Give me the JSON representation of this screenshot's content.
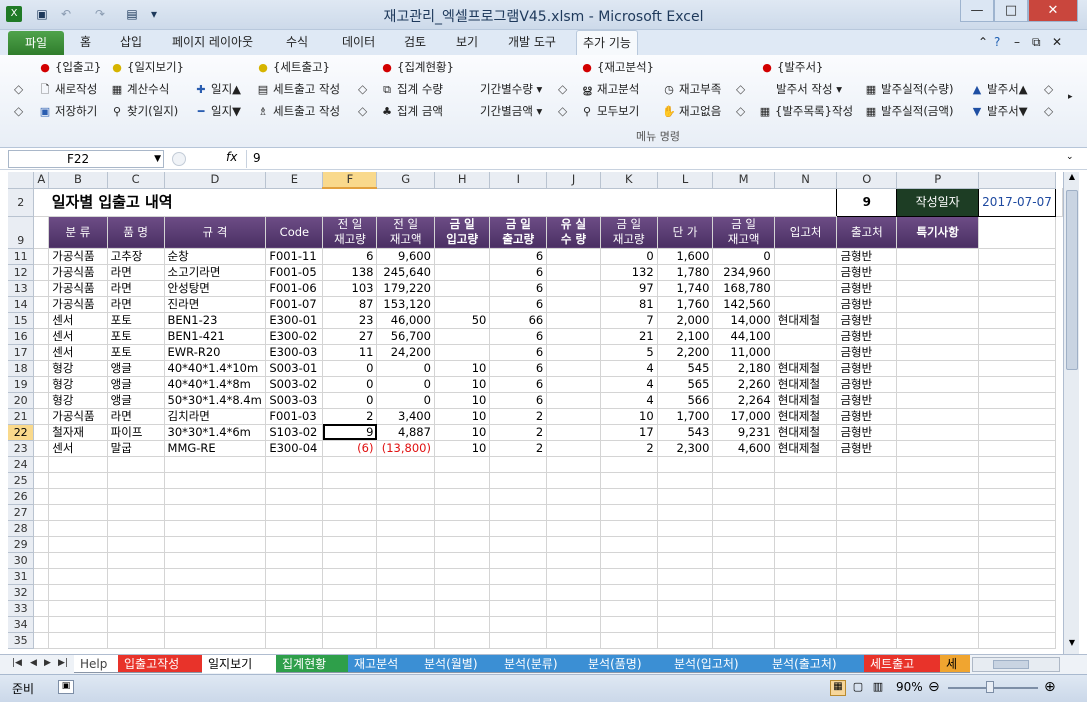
{
  "window": {
    "title": "재고관리_엑셀프로그램V45.xlsm  -  Microsoft Excel"
  },
  "tabs": [
    "홈",
    "삽입",
    "페이지 레이아웃",
    "수식",
    "데이터",
    "검토",
    "보기",
    "개발 도구",
    "추가 기능"
  ],
  "file_tab": "파일",
  "ribbon": {
    "r1": [
      "{입출고}",
      "{일지보기}",
      "{세트출고}",
      "{집계현황}",
      "{재고분석}",
      "{발주서}"
    ],
    "r2": [
      "새로작성",
      "계산수식",
      "일지▲",
      "세트출고 작성",
      "집계 수량",
      "기간별수량",
      "재고분석",
      "재고부족",
      "발주서 작성",
      "발주실적(수량)",
      "발주서▲"
    ],
    "r3": [
      "저장하기",
      "찾기(일지)",
      "일지▼",
      "세트출고 작성",
      "집계 금액",
      "기간별금액",
      "모두보기",
      "재고없음",
      "{발주목록}작성",
      "발주실적(금액)",
      "발주서▼"
    ],
    "group": "메뉴 명령"
  },
  "formula": {
    "cell": "F22",
    "fx": "fx",
    "value": "9"
  },
  "columns": [
    "A",
    "B",
    "C",
    "D",
    "E",
    "F",
    "G",
    "H",
    "I",
    "J",
    "K",
    "L",
    "M",
    "N",
    "O",
    "P",
    ""
  ],
  "sheet": {
    "title": "일자별 입출고 내역",
    "day": "9",
    "day_label": "작성일자",
    "date": "2017-07-07",
    "headers": [
      "분 류",
      "품 명",
      "규 격",
      "Code",
      "전 일\n재고량",
      "전 일\n재고액",
      "금 일\n입고량",
      "금 일\n출고량",
      "유 실\n수 량",
      "금 일\n재고량",
      "단 가",
      "금 일\n재고액",
      "입고처",
      "출고처",
      "특기사항"
    ],
    "rows": [
      [
        "11",
        "가공식품",
        "고추장",
        "순창",
        "F001-11",
        "6",
        "9,600",
        "",
        "6",
        "",
        "0",
        "1,600",
        "0",
        "",
        "금형반",
        ""
      ],
      [
        "12",
        "가공식품",
        "라면",
        "소고기라면",
        "F001-05",
        "138",
        "245,640",
        "",
        "6",
        "",
        "132",
        "1,780",
        "234,960",
        "",
        "금형반",
        ""
      ],
      [
        "13",
        "가공식품",
        "라면",
        "안성탕면",
        "F001-06",
        "103",
        "179,220",
        "",
        "6",
        "",
        "97",
        "1,740",
        "168,780",
        "",
        "금형반",
        ""
      ],
      [
        "14",
        "가공식품",
        "라면",
        "진라면",
        "F001-07",
        "87",
        "153,120",
        "",
        "6",
        "",
        "81",
        "1,760",
        "142,560",
        "",
        "금형반",
        ""
      ],
      [
        "15",
        "센서",
        "포토",
        "BEN1-23",
        "E300-01",
        "23",
        "46,000",
        "50",
        "66",
        "",
        "7",
        "2,000",
        "14,000",
        "현대제철",
        "금형반",
        ""
      ],
      [
        "16",
        "센서",
        "포토",
        "BEN1-421",
        "E300-02",
        "27",
        "56,700",
        "",
        "6",
        "",
        "21",
        "2,100",
        "44,100",
        "",
        "금형반",
        ""
      ],
      [
        "17",
        "센서",
        "포토",
        "EWR-R20",
        "E300-03",
        "11",
        "24,200",
        "",
        "6",
        "",
        "5",
        "2,200",
        "11,000",
        "",
        "금형반",
        ""
      ],
      [
        "18",
        "형강",
        "앵글",
        "40*40*1.4*10m",
        "S003-01",
        "0",
        "0",
        "10",
        "6",
        "",
        "4",
        "545",
        "2,180",
        "현대제철",
        "금형반",
        ""
      ],
      [
        "19",
        "형강",
        "앵글",
        "40*40*1.4*8m",
        "S003-02",
        "0",
        "0",
        "10",
        "6",
        "",
        "4",
        "565",
        "2,260",
        "현대제철",
        "금형반",
        ""
      ],
      [
        "20",
        "형강",
        "앵글",
        "50*30*1.4*8.4m",
        "S003-03",
        "0",
        "0",
        "10",
        "6",
        "",
        "4",
        "566",
        "2,264",
        "현대제철",
        "금형반",
        ""
      ],
      [
        "21",
        "가공식품",
        "라면",
        "김치라면",
        "F001-03",
        "2",
        "3,400",
        "10",
        "2",
        "",
        "10",
        "1,700",
        "17,000",
        "현대제철",
        "금형반",
        ""
      ],
      [
        "22",
        "철자재",
        "파이프",
        "30*30*1.4*6m",
        "S103-02",
        "9",
        "4,887",
        "10",
        "2",
        "",
        "17",
        "543",
        "9,231",
        "현대제철",
        "금형반",
        ""
      ],
      [
        "23",
        "센서",
        "말굽",
        "MMG-RE",
        "E300-04",
        "(6)",
        "(13,800)",
        "10",
        "2",
        "",
        "2",
        "2,300",
        "4,600",
        "현대제철",
        "금형반",
        ""
      ]
    ],
    "empty_rows": [
      "24",
      "25",
      "26",
      "27",
      "28",
      "29",
      "30",
      "31",
      "32",
      "33",
      "34",
      "35"
    ]
  },
  "sheet_tabs": [
    "Help",
    "입출고작성",
    "일지보기",
    "집계현황",
    "재고분석",
    "분석(월별)",
    "분석(분류)",
    "분석(품명)",
    "분석(입고처)",
    "분석(출고처)",
    "세트출고",
    "세트"
  ],
  "status": {
    "ready": "준비",
    "zoom": "90%"
  }
}
